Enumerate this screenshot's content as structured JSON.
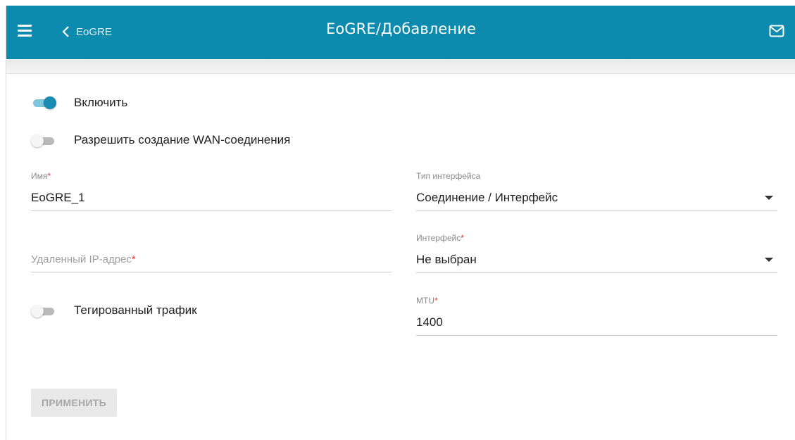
{
  "header": {
    "back_label": "EoGRE",
    "title": "EoGRE/Добавление",
    "background": "#0c8bae"
  },
  "toggles": {
    "enable": {
      "label": "Включить",
      "on": true
    },
    "allow_wan": {
      "label": "Разрешить создание WAN-соединения",
      "on": false
    },
    "tagged": {
      "label": "Тегированный трафик",
      "on": false
    }
  },
  "fields": {
    "name": {
      "label": "Имя",
      "required_mark": "*",
      "value": "EoGRE_1"
    },
    "remote_ip": {
      "label": "Удаленный IP-адрес",
      "required_mark": "*",
      "value": ""
    },
    "interface_type": {
      "label": "Тип интерфейса",
      "value": "Соединение / Интерфейс"
    },
    "interface": {
      "label": "Интерфейс",
      "required_mark": "*",
      "value": "Не выбран"
    },
    "mtu": {
      "label": "MTU",
      "required_mark": "*",
      "value": "1400"
    }
  },
  "actions": {
    "apply_label": "ПРИМЕНИТЬ"
  },
  "icons": {
    "menu": "hamburger-icon",
    "back": "chevron-left-icon",
    "mail": "mail-icon",
    "dropdown": "caret-down-icon"
  }
}
